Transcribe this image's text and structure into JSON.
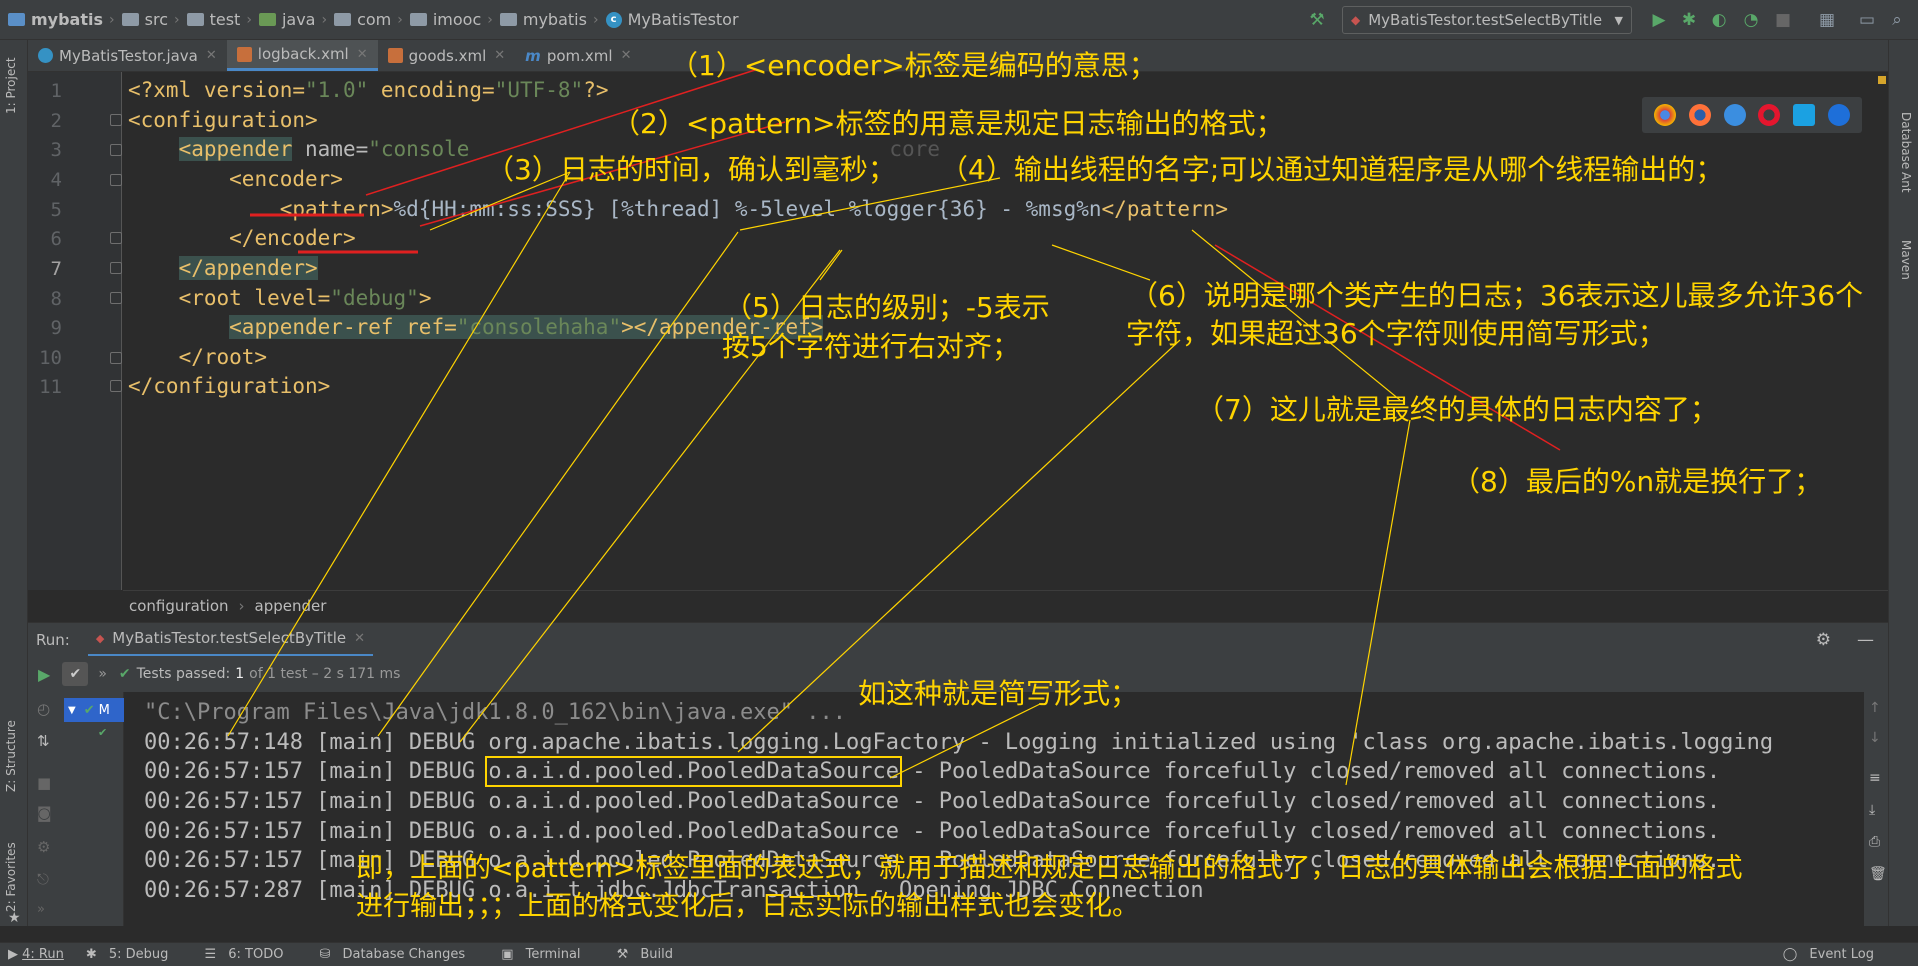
{
  "navbar": {
    "crumbs": [
      "mybatis",
      "src",
      "test",
      "java",
      "com",
      "imooc",
      "mybatis",
      "MyBatisTestor"
    ],
    "run_config": "MyBatisTestor.testSelectByTitle"
  },
  "tabs": [
    {
      "label": "MyBatisTestor.java",
      "active": false
    },
    {
      "label": "logback.xml",
      "active": true
    },
    {
      "label": "goods.xml",
      "active": false
    },
    {
      "label": "pom.xml",
      "active": false
    }
  ],
  "left_strip": {
    "project": "1: Project",
    "structure": "Z: Structure",
    "favorites": "2: Favorites"
  },
  "right_strip": {
    "database": "Database",
    "ant": "Ant",
    "maven": "Maven"
  },
  "editor": {
    "line_numbers": [
      "1",
      "2",
      "3",
      "4",
      "5",
      "6",
      "7",
      "8",
      "9",
      "10",
      "11"
    ],
    "lines": {
      "l1_a": "<?xml version=",
      "l1_b": "\"1.0\"",
      "l1_c": " encoding=",
      "l1_d": "\"UTF-8\"",
      "l1_e": "?>",
      "l2": "<configuration>",
      "l3_a": "<appender",
      " l3_b": " name=",
      "l3_c": "\"console",
      "l3_d": "core",
      "l4": "<encoder>",
      "l5_a": "<pattern>",
      "l5_b": "%d{HH:mm:ss:SSS} [%thread] %-5level %logger{36} - %msg%n",
      "l5_c": "</pattern>",
      "l6": "</encoder>",
      "l7": "</appender>",
      "l8_a": "<root level=",
      "l8_b": "\"debug\"",
      "l8_c": ">",
      "l9_a": "<appender-ref ref=",
      "l9_b": "\"consolehaha\"",
      "l9_c": "></appender-ref>",
      "l10": "</root>",
      "l11": "</configuration>"
    },
    "breadcrumb": [
      "configuration",
      "appender"
    ]
  },
  "run": {
    "label": "Run:",
    "tab": "MyBatisTestor.testSelectByTitle",
    "status": "Tests passed:",
    "status_count": "1",
    "status_rest": "of 1 test – 2 s 171 ms",
    "tree_item": "M",
    "console": [
      "\"C:\\Program Files\\Java\\jdk1.8.0_162\\bin\\java.exe\" ...",
      "00:26:57:148 [main] DEBUG org.apache.ibatis.logging.LogFactory - Logging initialized using 'class org.apache.ibatis.logging",
      "00:26:57:157 [main] DEBUG ",
      "o.a.i.d.pooled.PooledDataSource",
      " - PooledDataSource forcefully closed/removed all connections.",
      "00:26:57:157 [main] DEBUG o.a.i.d.pooled.PooledDataSource - PooledDataSource forcefully closed/removed all connections.",
      "00:26:57:157 [main] DEBUG o.a.i.d.pooled.PooledDataSource - PooledDataSource forcefully closed/removed all connections.",
      "00:26:57:157 [main] DEBUG o.a.i.d.pooled.PooledDataSource - PooledDataSource forcefully closed/removed all connections.",
      "00:26:57:287 [main] DEBUG o.a.i.t.jdbc.JdbcTransaction - Opening JDBC Connection"
    ]
  },
  "statusbar": {
    "run": "4: Run",
    "debug": "5: Debug",
    "todo": "6: TODO",
    "dbchanges": "Database Changes",
    "terminal": "Terminal",
    "build": "Build",
    "eventlog": "Event Log"
  },
  "annotations": {
    "a1": "（1）<encoder>标签是编码的意思；",
    "a2": "（2）<pattern>标签的用意是规定日志输出的格式；",
    "a3": "（3）日志的时间，确认到毫秒；",
    "a4": "（4）输出线程的名字;可以通过知道程序是从哪个线程输出的；",
    "a5_1": "（5）日志的级别；-5表示",
    "a5_2": "按5个字符进行右对齐；",
    "a6_1": "（6）说明是哪个类产生的日志；36表示这儿最多允许36个",
    "a6_2": "字符，如果超过36个字符则使用简写形式；",
    "a7": "（7）这儿就是最终的具体的日志内容了；",
    "a8": "（8）最后的%n就是换行了；",
    "a9": "如这种就是简写形式；",
    "a10_1": "即，上面的<pattern>标签里面的表达式，就用于描述和规定日志输出的格式了，日志的具体输出会根据上面的格式",
    "a10_2": "进行输出；；；上面的格式变化后，日志实际的输出样式也会变化。"
  },
  "colors": {
    "annotation": "#ffd400",
    "arrow_red": "#e02020",
    "tag": "#e8bf6a",
    "value": "#6a8759"
  }
}
